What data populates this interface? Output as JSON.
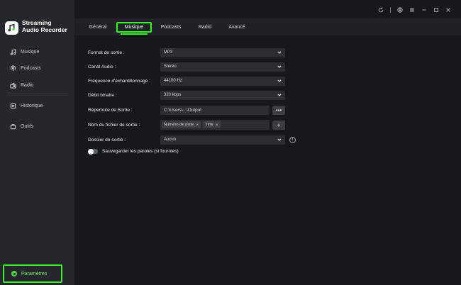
{
  "app": {
    "title_line1": "Streaming",
    "title_line2": "Audio Recorder"
  },
  "sidebar": {
    "items": [
      {
        "label": "Musique",
        "icon": "music-note-icon"
      },
      {
        "label": "Podcasts",
        "icon": "podcast-icon"
      },
      {
        "label": "Radio",
        "icon": "radio-icon"
      },
      {
        "label": "Historique",
        "icon": "history-icon"
      },
      {
        "label": "Outils",
        "icon": "toolbox-icon"
      }
    ],
    "settings_label": "Paramètres",
    "accent": "#3cf22a"
  },
  "titlebar": {
    "icons": [
      "refresh-icon",
      "account-icon",
      "menu-icon",
      "minimize-icon",
      "maximize-icon",
      "close-icon"
    ]
  },
  "tabs": [
    {
      "label": "Général",
      "active": false
    },
    {
      "label": "Musique",
      "active": true
    },
    {
      "label": "Podcasts",
      "active": false
    },
    {
      "label": "Radio",
      "active": false
    },
    {
      "label": "Avancé",
      "active": false
    }
  ],
  "form": {
    "format": {
      "label": "Format de sortie :",
      "value": "MP3"
    },
    "channel": {
      "label": "Canal Audio :",
      "value": "Stéréo"
    },
    "sample_rate": {
      "label": "Fréquence d'échantillonnage :",
      "value": "44100 Hz"
    },
    "bitrate": {
      "label": "Débit binaire :",
      "value": "320 kbps"
    },
    "output_dir": {
      "label": "Répertoire de Sortie :",
      "value": "C:\\Users\\...\\Output",
      "browse": "•••"
    },
    "filename": {
      "label": "Nom du fichier de sortie :",
      "tags": [
        "Numéro de piste",
        "Titre"
      ],
      "add": "+"
    },
    "output_folder": {
      "label": "Dossier de sortie :",
      "value": "Aucun"
    },
    "lyrics_toggle": {
      "label": "Sauvegarder les paroles (si fournies)",
      "on": false
    }
  }
}
